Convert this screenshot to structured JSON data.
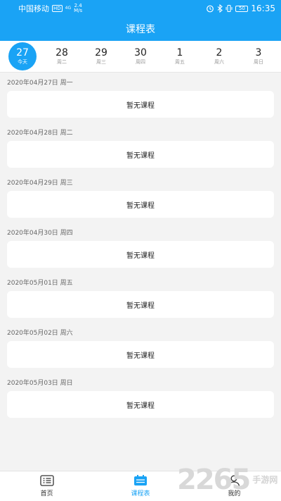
{
  "status_bar": {
    "carrier": "中国移动",
    "hd": "HD",
    "signal_top": "4G",
    "speed_value": "2.4",
    "speed_unit": "M/s",
    "battery": "50",
    "time": "16:35"
  },
  "header": {
    "title": "课程表"
  },
  "week": [
    {
      "num": "27",
      "label": "今天",
      "active": true
    },
    {
      "num": "28",
      "label": "周二",
      "active": false
    },
    {
      "num": "29",
      "label": "周三",
      "active": false
    },
    {
      "num": "30",
      "label": "周四",
      "active": false
    },
    {
      "num": "1",
      "label": "周五",
      "active": false
    },
    {
      "num": "2",
      "label": "周六",
      "active": false
    },
    {
      "num": "3",
      "label": "周日",
      "active": false
    }
  ],
  "schedule": [
    {
      "date": "2020年04月27日 周一",
      "course": "暂无课程"
    },
    {
      "date": "2020年04月28日 周二",
      "course": "暂无课程"
    },
    {
      "date": "2020年04月29日 周三",
      "course": "暂无课程"
    },
    {
      "date": "2020年04月30日 周四",
      "course": "暂无课程"
    },
    {
      "date": "2020年05月01日 周五",
      "course": "暂无课程"
    },
    {
      "date": "2020年05月02日 周六",
      "course": "暂无课程"
    },
    {
      "date": "2020年05月03日 周日",
      "course": "暂无课程"
    }
  ],
  "tabbar": {
    "home": "首页",
    "schedule": "课程表",
    "mine": "我的"
  },
  "watermark": {
    "number": "2265",
    "name": "手游网"
  },
  "colors": {
    "primary": "#1aa3f5",
    "background": "#f3f3f3"
  }
}
